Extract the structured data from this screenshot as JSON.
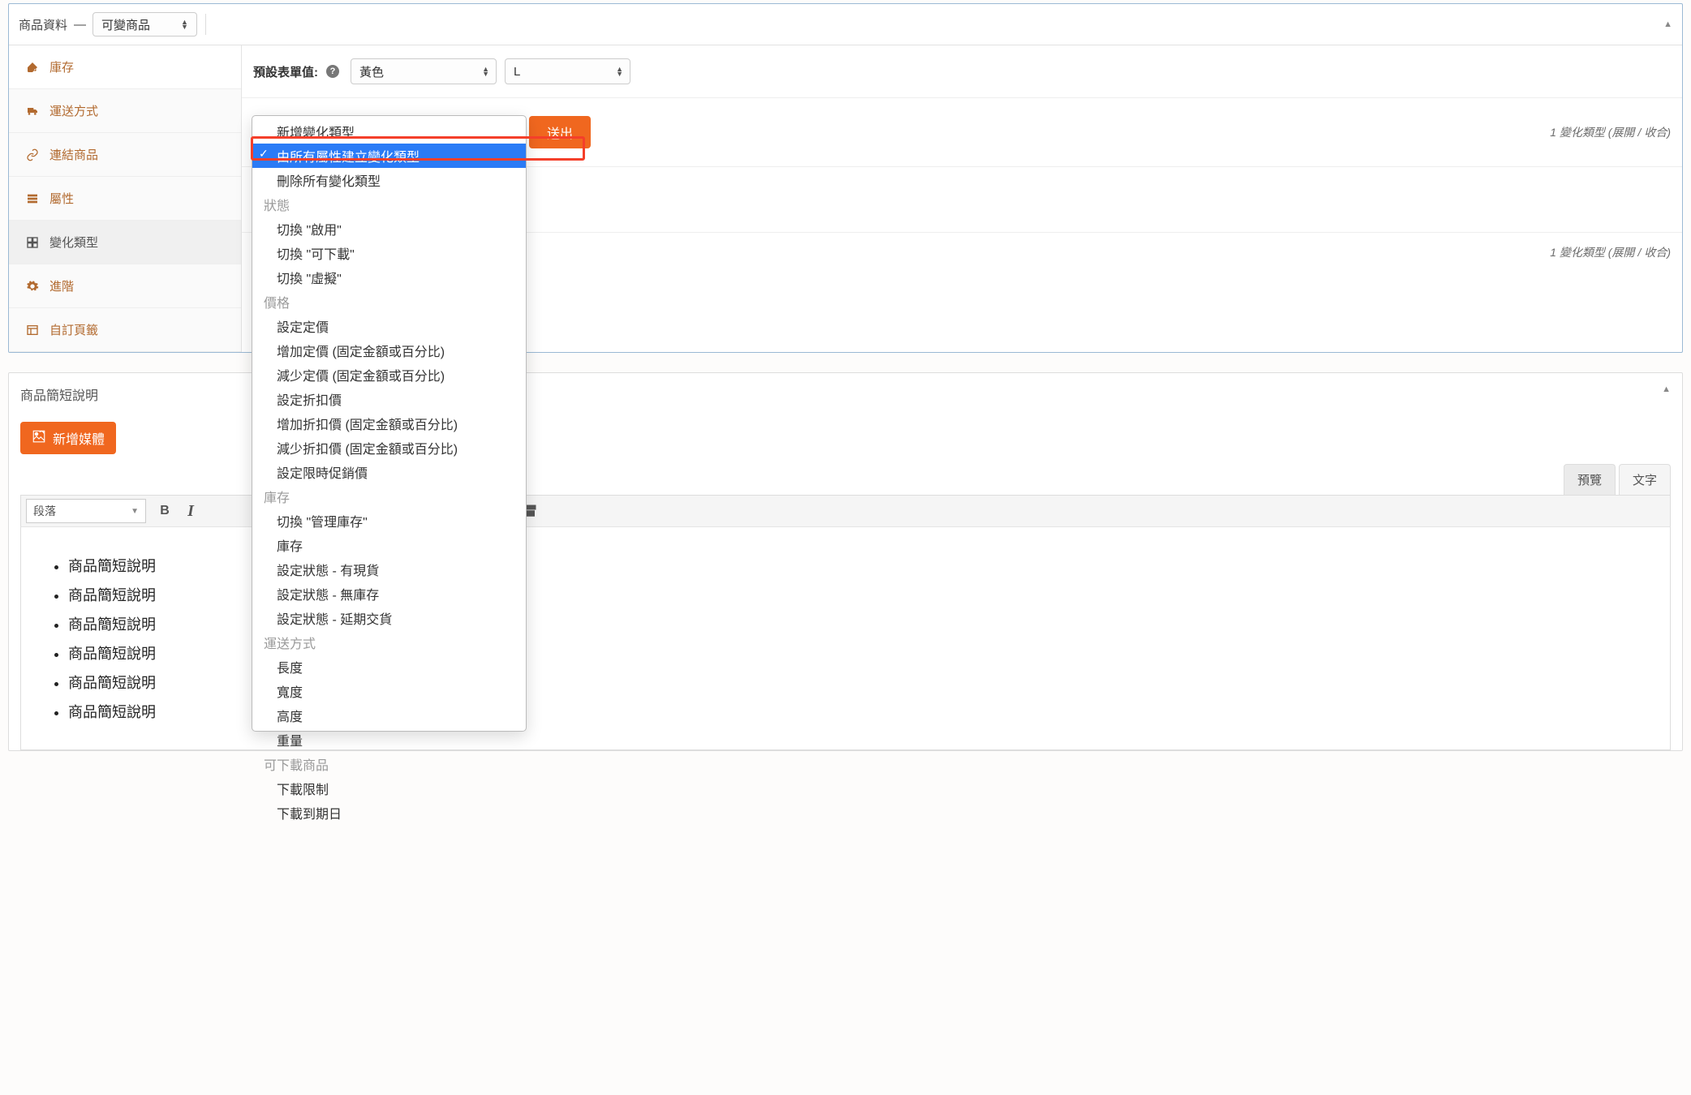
{
  "pd_header": {
    "title": "商品資料",
    "sep": "—",
    "type_value": "可變商品"
  },
  "sidebar": {
    "items": [
      {
        "label": "庫存"
      },
      {
        "label": "運送方式"
      },
      {
        "label": "連結商品"
      },
      {
        "label": "屬性"
      },
      {
        "label": "變化類型"
      },
      {
        "label": "進階"
      },
      {
        "label": "自訂頁籤"
      }
    ]
  },
  "defaults": {
    "label": "預設表單值:",
    "color_value": "黃色",
    "size_value": "L"
  },
  "submit_label": "送出",
  "var_summary": {
    "count_text": "1 變化類型",
    "expand": "展開",
    "collapse": "收合"
  },
  "dropdown": {
    "items": [
      "新增變化類型",
      "由所有屬性建立變化類型",
      "刪除所有變化類型"
    ],
    "groups": [
      {
        "label": "狀態",
        "items": [
          "切換 \"啟用\"",
          "切換 \"可下載\"",
          "切換 \"虛擬\""
        ]
      },
      {
        "label": "價格",
        "items": [
          "設定定價",
          "增加定價 (固定金額或百分比)",
          "減少定價 (固定金額或百分比)",
          "設定折扣價",
          "增加折扣價 (固定金額或百分比)",
          "減少折扣價 (固定金額或百分比)",
          "設定限時促銷價"
        ]
      },
      {
        "label": "庫存",
        "items": [
          "切換 \"管理庫存\"",
          "庫存",
          "設定狀態 - 有現貨",
          "設定狀態 - 無庫存",
          "設定狀態 - 延期交貨"
        ]
      },
      {
        "label": "運送方式",
        "items": [
          "長度",
          "寬度",
          "高度",
          "重量"
        ]
      },
      {
        "label": "可下載商品",
        "items": [
          "下載限制",
          "下載到期日"
        ]
      }
    ]
  },
  "short_desc": {
    "title": "商品簡短說明",
    "add_media": "新增媒體",
    "tabs": {
      "visual": "預覽",
      "text": "文字"
    },
    "paragraph_label": "段落",
    "bullets": [
      "商品簡短說明",
      "商品簡短說明",
      "商品簡短說明",
      "商品簡短說明",
      "商品簡短說明",
      "商品簡短說明"
    ]
  }
}
